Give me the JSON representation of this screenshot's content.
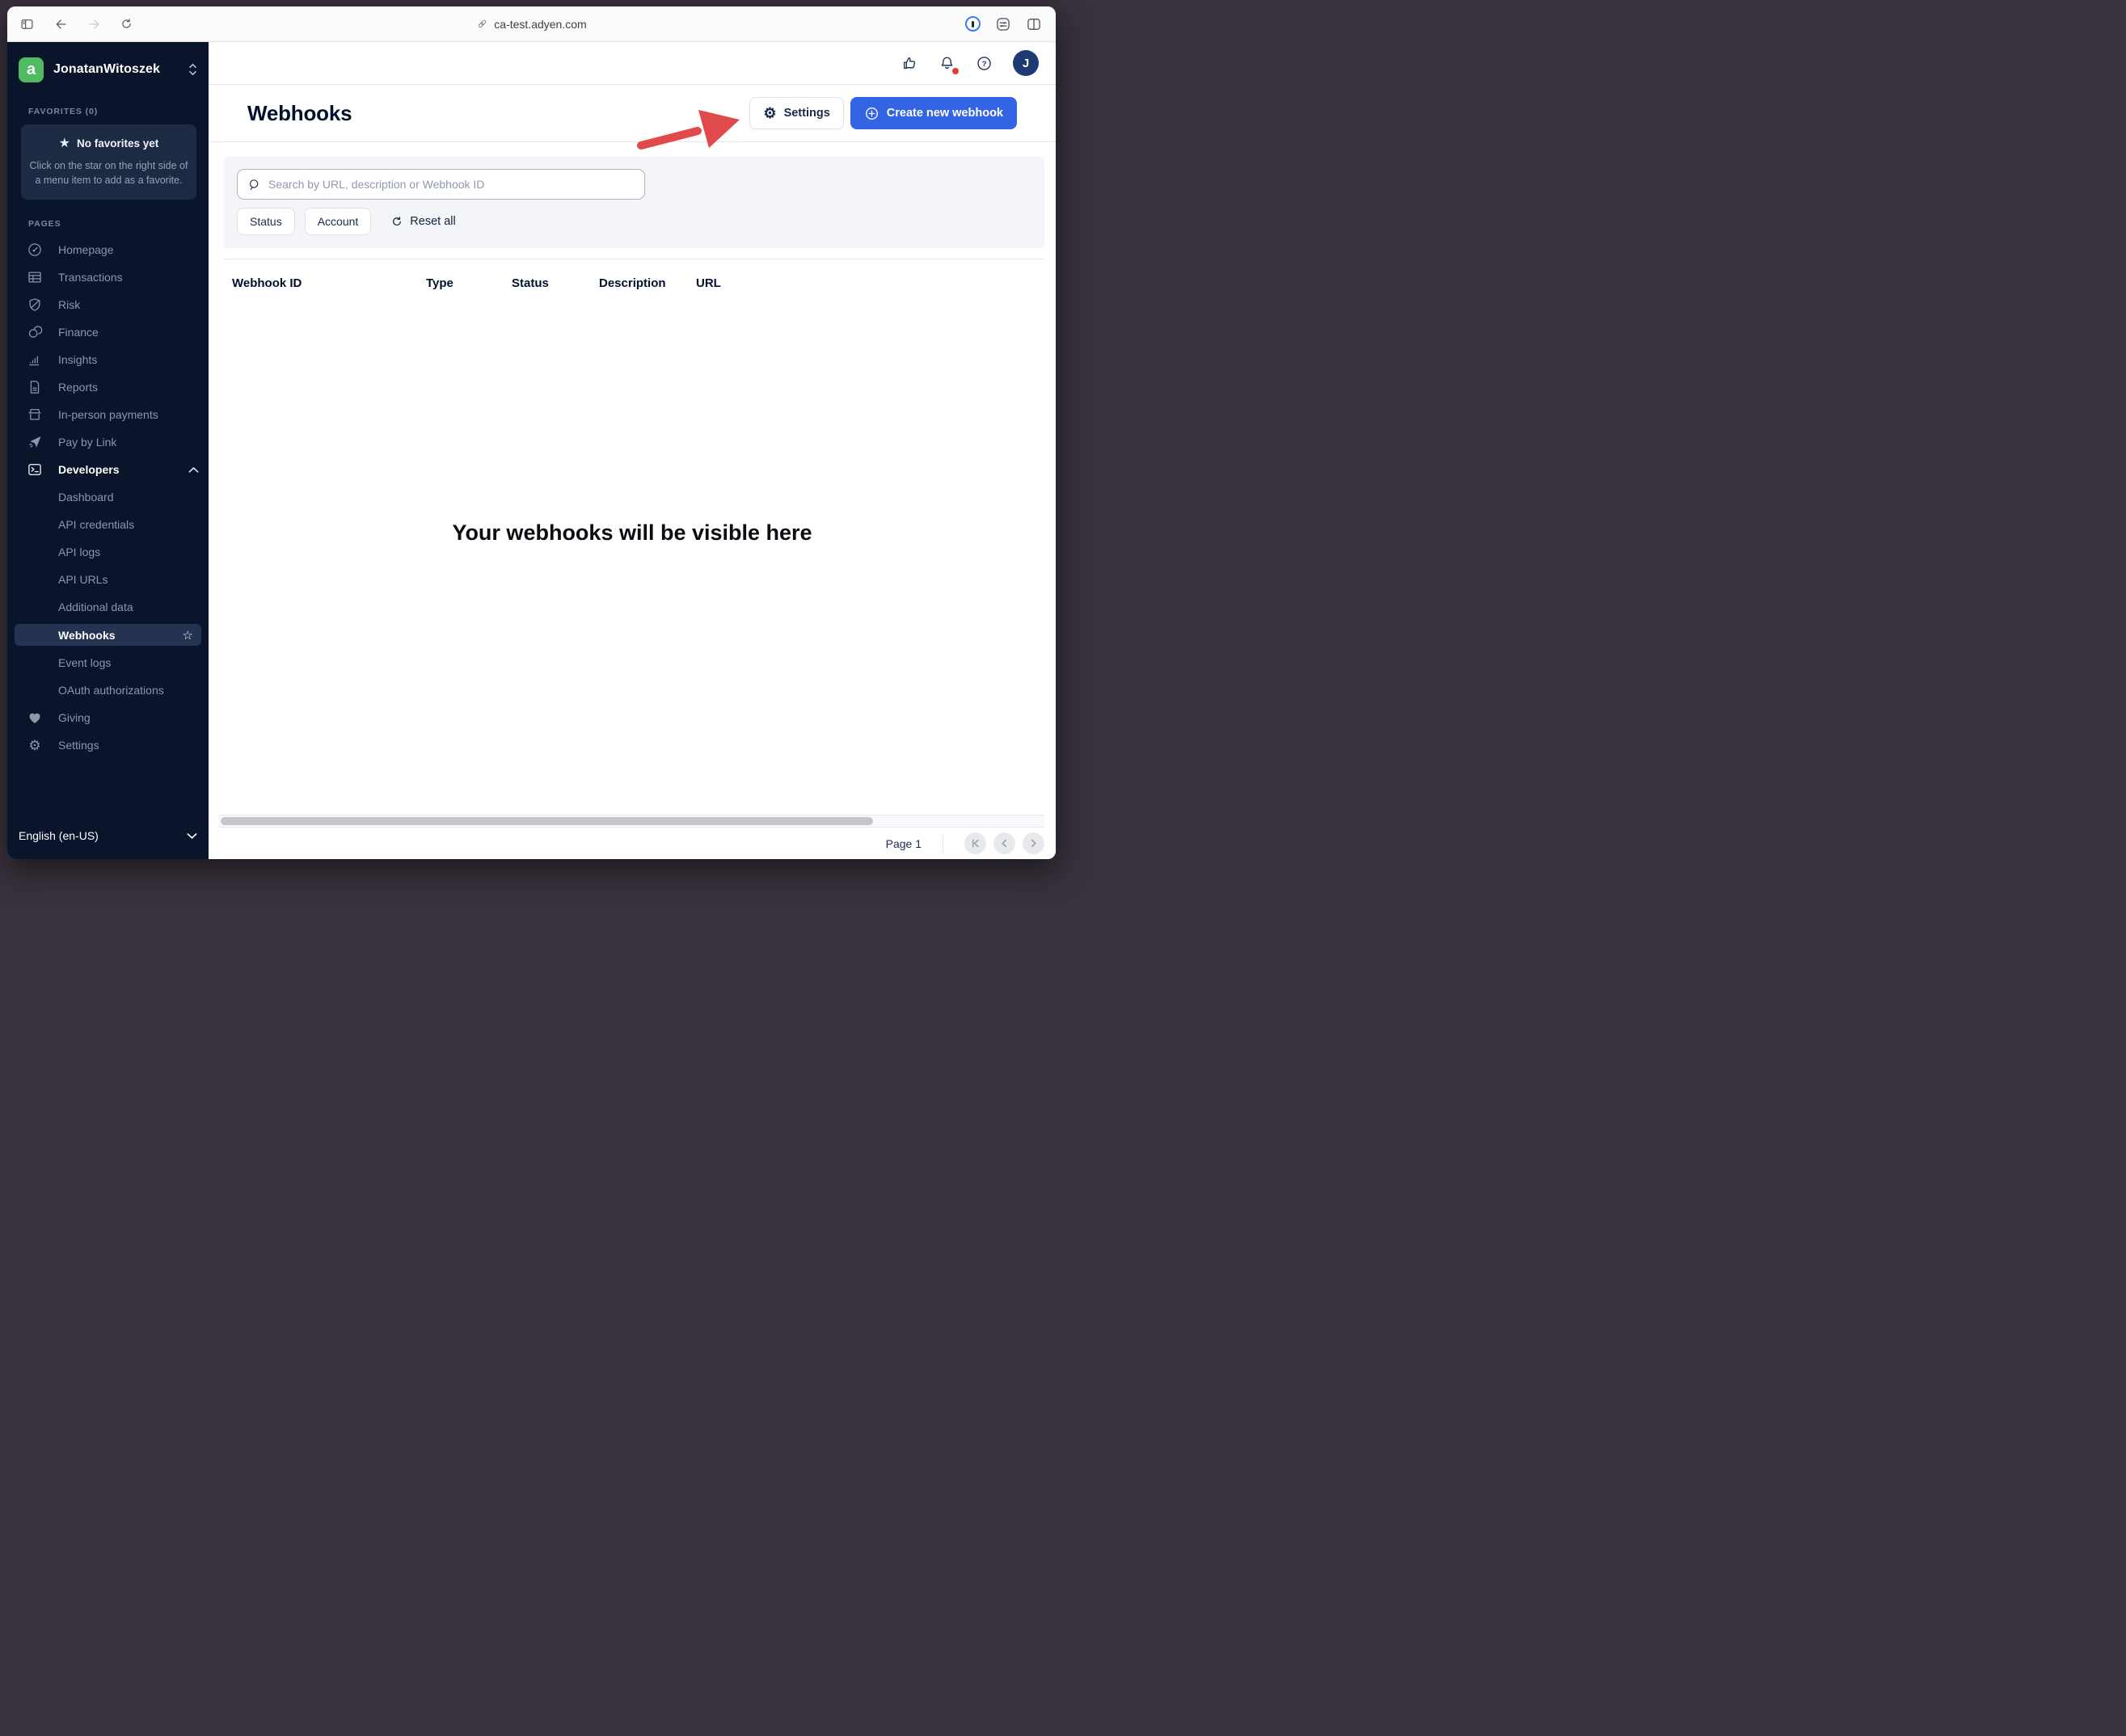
{
  "browser": {
    "url": "ca-test.adyen.com"
  },
  "sidebar": {
    "account_name": "JonatanWitoszek",
    "favorites_label": "FAVORITES (0)",
    "favorites_title": "No favorites yet",
    "favorites_hint": "Click on the star on the right side of a menu item to add as a favorite.",
    "pages_label": "PAGES",
    "items": [
      {
        "label": "Homepage",
        "icon": "gauge-icon"
      },
      {
        "label": "Transactions",
        "icon": "table-icon"
      },
      {
        "label": "Risk",
        "icon": "shield-icon"
      },
      {
        "label": "Finance",
        "icon": "coins-icon"
      },
      {
        "label": "Insights",
        "icon": "bar-chart-icon"
      },
      {
        "label": "Reports",
        "icon": "document-icon"
      },
      {
        "label": "In-person payments",
        "icon": "store-icon"
      },
      {
        "label": "Pay by Link",
        "icon": "paper-plane-icon"
      },
      {
        "label": "Developers",
        "icon": "terminal-icon",
        "expanded": true
      },
      {
        "label": "Dashboard",
        "child": true
      },
      {
        "label": "API credentials",
        "child": true
      },
      {
        "label": "API logs",
        "child": true
      },
      {
        "label": "API URLs",
        "child": true
      },
      {
        "label": "Additional data",
        "child": true
      },
      {
        "label": "Webhooks",
        "child": true,
        "selected": true
      },
      {
        "label": "Event logs",
        "child": true
      },
      {
        "label": "OAuth authorizations",
        "child": true
      },
      {
        "label": "Giving",
        "icon": "heart-icon"
      },
      {
        "label": "Settings",
        "icon": "gear-icon"
      }
    ],
    "language": "English (en-US)"
  },
  "header": {
    "avatar_initial": "J"
  },
  "page": {
    "title": "Webhooks",
    "settings_button": "Settings",
    "create_button": "Create new webhook"
  },
  "filters": {
    "search_placeholder": "Search by URL, description or Webhook ID",
    "status_button": "Status",
    "account_button": "Account",
    "reset_button": "Reset all"
  },
  "table": {
    "columns": [
      "Webhook ID",
      "Type",
      "Status",
      "Description",
      "URL"
    ],
    "empty_message": "Your webhooks will be visible here"
  },
  "pagination": {
    "page_label": "Page 1"
  },
  "colors": {
    "sidebar_bg": "#0a142b",
    "accent_blue": "#3364e3",
    "logo_green": "#52b963",
    "arrow_red": "#e04a4a",
    "navy_text": "#00112c",
    "notification_red": "#e33b34",
    "frame_bg": "#39313c"
  }
}
